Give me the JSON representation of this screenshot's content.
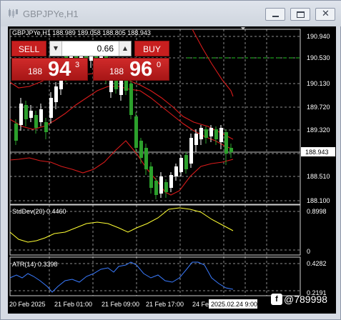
{
  "window": {
    "title": "GBPJPYe,H1"
  },
  "chart": {
    "symbol_info": "GBPJPYe,H1  188.989 189.058 188.805 188.943",
    "price_axis": [
      "190.940",
      "190.530",
      "190.130",
      "189.720",
      "189.320",
      "188.510",
      "188.100"
    ],
    "current_price": "188.943",
    "time_axis": [
      "20 Feb 2025",
      "21 Feb 01:00",
      "21 Feb 09:00",
      "21 Feb 17:00",
      "24 Feb"
    ],
    "time_highlight": "2025.02.24 9:00",
    "colors": {
      "background": "#000000",
      "bull": "#ffffff",
      "bear": "#2ca02c",
      "bands": "#e02020",
      "stddev": "#ffff33",
      "atr": "#3a7bff",
      "grid": "#ffffff"
    }
  },
  "stddev": {
    "label": "StdDev(20) 0.4460",
    "axis_max": "0.8998",
    "axis_min": "0"
  },
  "atr": {
    "label": "ATR(14) 0.3398",
    "axis_max": "0.4282",
    "axis_min": "0.2191"
  },
  "trade": {
    "sell_label": "SELL",
    "buy_label": "BUY",
    "lot": "0.66",
    "bid": {
      "small": "188",
      "big": "94",
      "sup": "3"
    },
    "ask": {
      "small": "188",
      "big": "96",
      "sup": "0"
    }
  },
  "watermark": {
    "text": "@789998"
  },
  "icons": {
    "title": "candlestick-chart-icon",
    "minimize": "minimize-icon",
    "maximize": "maximize-icon",
    "close": "close-icon"
  }
}
